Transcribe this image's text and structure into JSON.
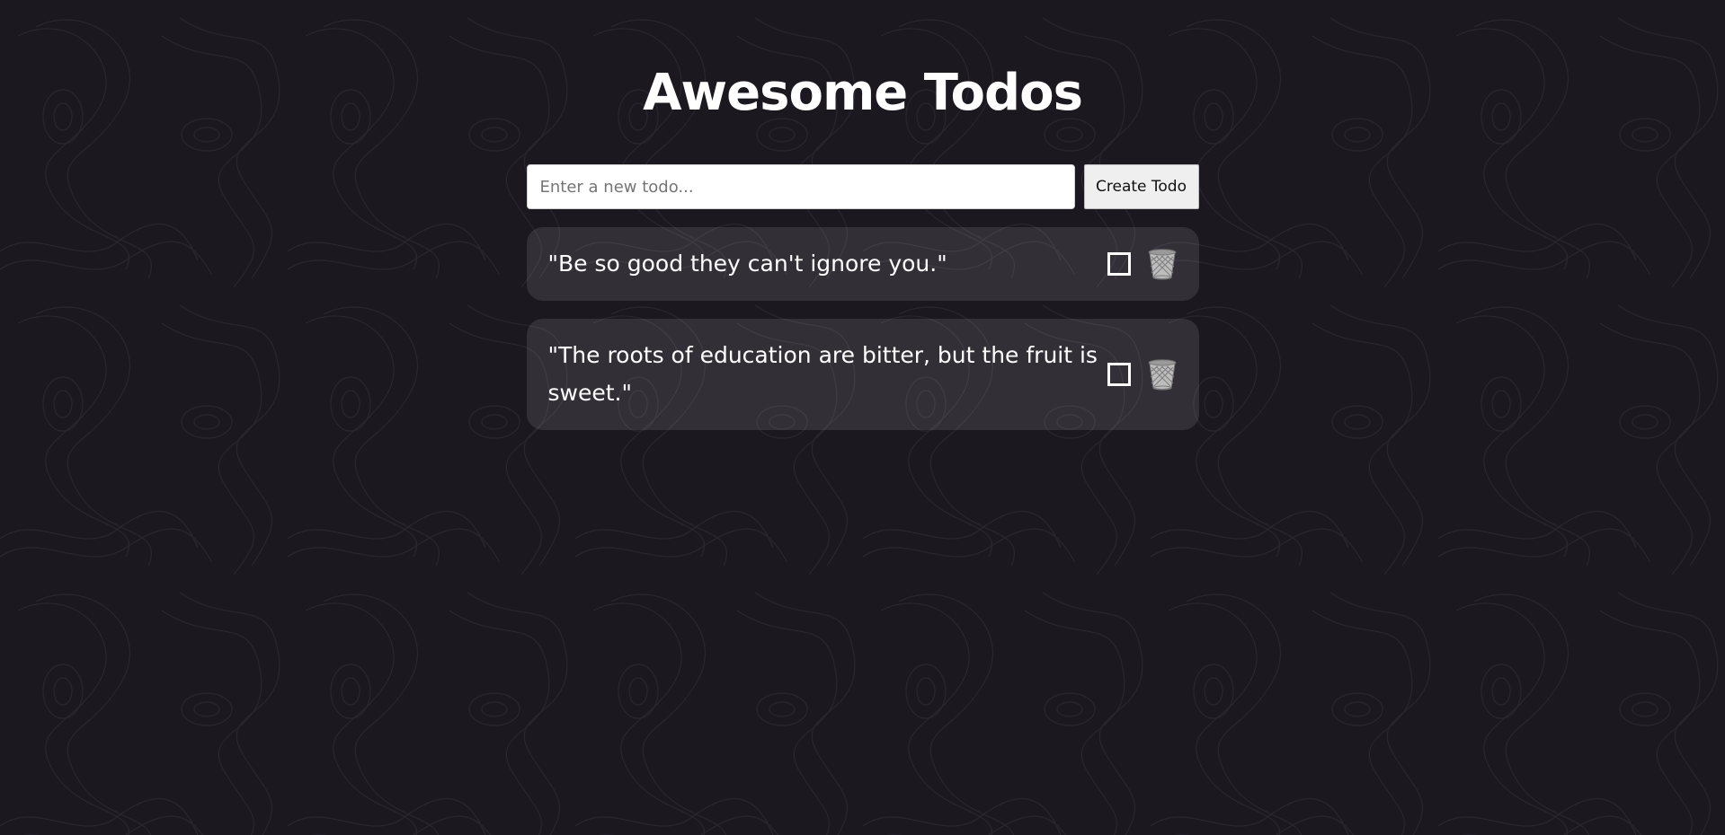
{
  "header": {
    "title": "Awesome Todos"
  },
  "form": {
    "input_placeholder": "Enter a new todo...",
    "input_value": "",
    "create_label": "Create Todo"
  },
  "todos": [
    {
      "text": "\"Be so good they can't ignore you.\"",
      "completed": false
    },
    {
      "text": "\"The roots of education are bitter, but the fruit is sweet.\"",
      "completed": false
    }
  ],
  "icons": {
    "checkbox": "checkbox-icon",
    "delete": "wastebasket-icon"
  },
  "colors": {
    "background": "#1b1820",
    "card": "#37343c",
    "text": "#ffffff"
  }
}
